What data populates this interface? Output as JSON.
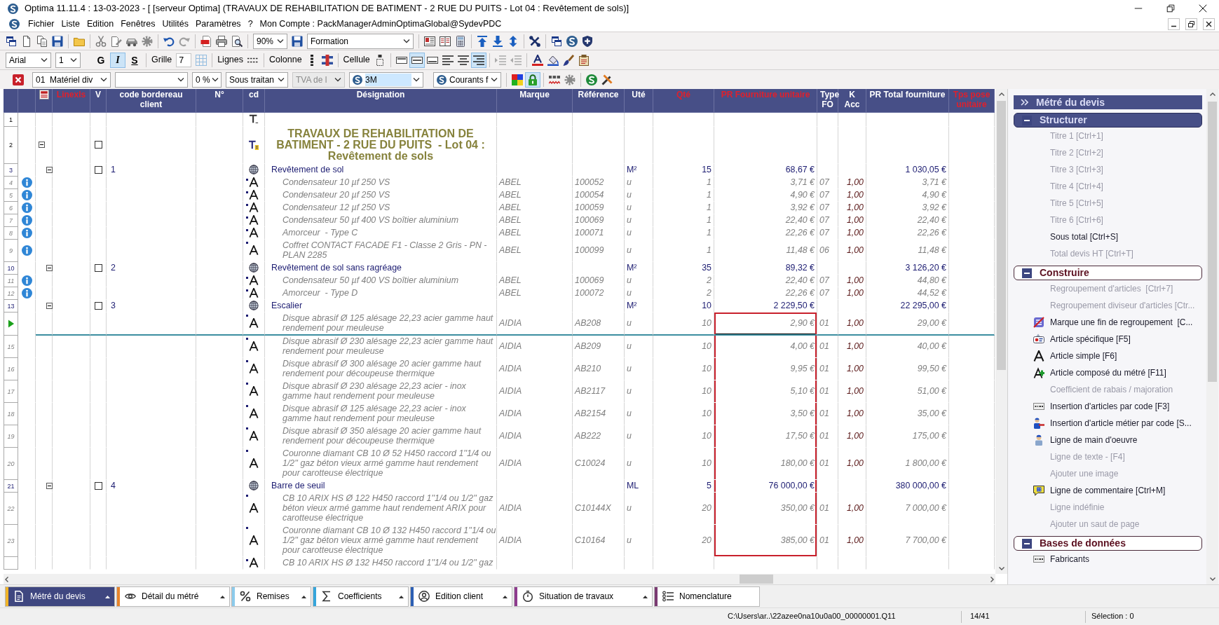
{
  "window": {
    "title": "Optima 11.11.4 : 13-03-2023 - [ [serveur Optima] (TRAVAUX DE REHABILITATION DE BATIMENT - 2 RUE DU PUITS - Lot 04 : Revêtement de sols)]"
  },
  "menu": {
    "items": [
      "Fichier",
      "Liste",
      "Edition",
      "Fenêtres",
      "Utilités",
      "Paramètres",
      "?"
    ],
    "account": "Mon Compte : PackManagerAdminOptimaGlobal@SydevPDC"
  },
  "main_toolbar": {
    "zoom": "90%",
    "profile": "Formation"
  },
  "format_bar": {
    "font": "Arial",
    "size": "1",
    "bold": {
      "label": "G",
      "pressed": false
    },
    "italic": {
      "label": "I",
      "pressed": true
    },
    "underline": {
      "label": "S",
      "pressed": false
    },
    "grid_label": "Grille",
    "grid_value": "7",
    "lines_label": "Lignes",
    "column_label": "Colonne",
    "cell_label": "Cellule",
    "border_buttons": [
      {
        "pressed": false
      },
      {
        "pressed": true
      },
      {
        "pressed": false
      }
    ],
    "align_buttons": [
      {
        "pressed": false
      },
      {
        "pressed": false
      },
      {
        "pressed": true
      }
    ]
  },
  "filter_bar": {
    "category": "01  Matériel div",
    "discount": "0 %",
    "subcontract": "Sous traitan",
    "vat": {
      "value": "TVA de l",
      "disabled": true
    },
    "supplier": {
      "value": "3M",
      "highlighted": true
    },
    "tariff": "Courants f",
    "lock_pressed": true
  },
  "table": {
    "columns": [
      {
        "label": "Linexls",
        "highlighted": true
      },
      {
        "label": "V",
        "highlighted": false
      },
      {
        "label": "code bordereau client",
        "highlighted": false
      },
      {
        "label": "N°",
        "highlighted": false
      },
      {
        "label": "cd",
        "highlighted": false
      },
      {
        "label": "Désignation",
        "highlighted": false
      },
      {
        "label": "Marque",
        "highlighted": false
      },
      {
        "label": "Référence",
        "highlighted": false
      },
      {
        "label": "Uté",
        "highlighted": false
      },
      {
        "label": "Qté",
        "highlighted": true
      },
      {
        "label": "PR Fourniture unitaire",
        "highlighted": true
      },
      {
        "label": "Type FO",
        "highlighted": false
      },
      {
        "label": "K Acc",
        "highlighted": false
      },
      {
        "label": "PR Total fourniture",
        "highlighted": false
      },
      {
        "label": "Tps pose unitaire",
        "highlighted": true
      }
    ],
    "rows": [
      {
        "number": "1",
        "kind": "text",
        "info": false,
        "current": false,
        "selected": false
      },
      {
        "number": "2",
        "kind": "title",
        "info": false,
        "current": false,
        "selected": false,
        "expanded": true,
        "checked": false,
        "designation": "TRAVAUX DE REHABILITATION DE BATIMENT - 2 RUE DU PUITS  - Lot 04 : Revêtement de sols",
        "children": [
          {
            "number": "3",
            "kind": "chapter",
            "info": false,
            "current": false,
            "selected": false,
            "expanded": true,
            "checked": false,
            "code": "1",
            "designation": "Revêtement de sol",
            "unit": "M²",
            "qty": "15",
            "unit_price": "68,67 €",
            "total": "1 030,05 €",
            "children": [
              {
                "number": "4",
                "kind": "article",
                "info": true,
                "current": false,
                "selected": false,
                "designation": "Condensateur 10 µf 250 VS",
                "brand": "ABEL",
                "reference": "100052",
                "unit": "u",
                "qty": "1",
                "unit_price": "3,71 €",
                "fo_type": "07",
                "k_acc": "1,00",
                "total": "3,71 €"
              },
              {
                "number": "5",
                "kind": "article",
                "info": true,
                "current": false,
                "selected": false,
                "designation": "Condensateur 20 µf 250 VS",
                "brand": "ABEL",
                "reference": "100054",
                "unit": "u",
                "qty": "1",
                "unit_price": "4,90 €",
                "fo_type": "07",
                "k_acc": "1,00",
                "total": "4,90 €"
              },
              {
                "number": "6",
                "kind": "article",
                "info": true,
                "current": false,
                "selected": false,
                "designation": "Condensateur 12 µf 250 VS",
                "brand": "ABEL",
                "reference": "100059",
                "unit": "u",
                "qty": "1",
                "unit_price": "3,92 €",
                "fo_type": "07",
                "k_acc": "1,00",
                "total": "3,92 €"
              },
              {
                "number": "7",
                "kind": "article",
                "info": true,
                "current": false,
                "selected": false,
                "designation": "Condensateur 50 µf 400 VS boîtier aluminium",
                "brand": "ABEL",
                "reference": "100069",
                "unit": "u",
                "qty": "1",
                "unit_price": "22,40 €",
                "fo_type": "07",
                "k_acc": "1,00",
                "total": "22,40 €"
              },
              {
                "number": "8",
                "kind": "article",
                "info": true,
                "current": false,
                "selected": false,
                "designation": "Amorceur  - Type C",
                "brand": "ABEL",
                "reference": "100071",
                "unit": "u",
                "qty": "1",
                "unit_price": "22,26 €",
                "fo_type": "07",
                "k_acc": "1,00",
                "total": "22,26 €"
              },
              {
                "number": "9",
                "kind": "article",
                "info": true,
                "current": false,
                "selected": false,
                "designation": "Coffret CONTACT FACADE F1 - Classe 2 Gris - PN - PLAN 2285",
                "brand": "ABEL",
                "reference": "100099",
                "unit": "u",
                "qty": "1",
                "unit_price": "11,48 €",
                "fo_type": "06",
                "k_acc": "1,00",
                "total": "11,48 €"
              }
            ]
          },
          {
            "number": "10",
            "kind": "chapter",
            "info": false,
            "current": false,
            "selected": false,
            "expanded": true,
            "checked": false,
            "code": "2",
            "designation": "Revêtement de sol sans ragréage",
            "unit": "M²",
            "qty": "35",
            "unit_price": "89,32 €",
            "total": "3 126,20 €",
            "children": [
              {
                "number": "11",
                "kind": "article",
                "info": true,
                "current": false,
                "selected": false,
                "designation": "Condensateur 50 µf 400 VS boîtier aluminium",
                "brand": "ABEL",
                "reference": "100069",
                "unit": "u",
                "qty": "2",
                "unit_price": "22,40 €",
                "fo_type": "07",
                "k_acc": "1,00",
                "total": "44,80 €"
              },
              {
                "number": "12",
                "kind": "article",
                "info": true,
                "current": false,
                "selected": false,
                "designation": "Amorceur  - Type D",
                "brand": "ABEL",
                "reference": "100072",
                "unit": "u",
                "qty": "2",
                "unit_price": "22,26 €",
                "fo_type": "07",
                "k_acc": "1,00",
                "total": "44,52 €"
              }
            ]
          },
          {
            "number": "13",
            "kind": "chapter",
            "info": false,
            "current": false,
            "selected": false,
            "expanded": true,
            "checked": false,
            "code": "3",
            "designation": "Escalier",
            "unit": "M²",
            "qty": "10",
            "unit_price": "2 229,50 €",
            "total": "22 295,00 €",
            "children": [
              {
                "kind": "article",
                "info": false,
                "current": true,
                "selected": true,
                "designation": "Disque abrasif Ø 125 alésage 22,23 acier gamme haut rendement pour meuleuse",
                "brand": "AIDIA",
                "reference": "AB208",
                "unit": "u",
                "qty": "10",
                "unit_price": "2,90 €",
                "fo_type": "01",
                "k_acc": "1,00",
                "total": "29,00 €"
              },
              {
                "number": "15",
                "kind": "article",
                "info": false,
                "current": false,
                "selected": true,
                "designation": "Disque abrasif Ø 230 alésage 22,23 acier gamme haut rendement pour meuleuse",
                "brand": "AIDIA",
                "reference": "AB209",
                "unit": "u",
                "qty": "10",
                "unit_price": "4,00 €",
                "fo_type": "01",
                "k_acc": "1,00",
                "total": "40,00 €"
              },
              {
                "number": "16",
                "kind": "article",
                "info": false,
                "current": false,
                "selected": true,
                "designation": "Disque abrasif Ø 300 alésage 20 acier gamme haut rendement pour découpeuse thermique",
                "brand": "AIDIA",
                "reference": "AB210",
                "unit": "u",
                "qty": "10",
                "unit_price": "9,95 €",
                "fo_type": "01",
                "k_acc": "1,00",
                "total": "99,50 €"
              },
              {
                "number": "17",
                "kind": "article",
                "info": false,
                "current": false,
                "selected": true,
                "designation": "Disque abrasif Ø 230 alésage 22,23 acier - inox gamme haut rendement pour meuleuse",
                "brand": "AIDIA",
                "reference": "AB2117",
                "unit": "u",
                "qty": "10",
                "unit_price": "5,10 €",
                "fo_type": "01",
                "k_acc": "1,00",
                "total": "51,00 €"
              },
              {
                "number": "18",
                "kind": "article",
                "info": false,
                "current": false,
                "selected": true,
                "designation": "Disque abrasif Ø 125 alésage 22,23 acier - inox gamme haut rendement pour meuleuse",
                "brand": "AIDIA",
                "reference": "AB2154",
                "unit": "u",
                "qty": "10",
                "unit_price": "3,50 €",
                "fo_type": "01",
                "k_acc": "1,00",
                "total": "35,00 €"
              },
              {
                "number": "19",
                "kind": "article",
                "info": false,
                "current": false,
                "selected": true,
                "designation": "Disque abrasif Ø 350 alésage 20 acier gamme haut rendement pour découpeuse thermique",
                "brand": "AIDIA",
                "reference": "AB222",
                "unit": "u",
                "qty": "10",
                "unit_price": "17,50 €",
                "fo_type": "01",
                "k_acc": "1,00",
                "total": "175,00 €"
              },
              {
                "number": "20",
                "kind": "article",
                "info": false,
                "current": false,
                "selected": true,
                "designation": "Couronne diamant CB 10 Ø 52 H450 raccord 1''1/4 ou 1/2'' gaz béton vieux armé gamme haut rendement pour carotteuse électrique",
                "brand": "AIDIA",
                "reference": "C10024",
                "unit": "u",
                "qty": "10",
                "unit_price": "180,00 €",
                "fo_type": "01",
                "k_acc": "1,00",
                "total": "1 800,00 €"
              }
            ]
          },
          {
            "number": "21",
            "kind": "chapter",
            "info": false,
            "current": false,
            "selected": true,
            "expanded": true,
            "checked": false,
            "code": "4",
            "designation": "Barre de seuil",
            "unit": "ML",
            "qty": "5",
            "unit_price": "76 000,00 €",
            "total": "380 000,00 €",
            "children": [
              {
                "number": "22",
                "kind": "article",
                "info": false,
                "current": false,
                "selected": true,
                "designation": "CB 10 ARIX HS Ø 122 H450 raccord 1''1/4 ou 1/2'' gaz béton vieux armé gamme haut rendement ARIX pour carotteuse électrique",
                "brand": "AIDIA",
                "reference": "C10144X",
                "unit": "u",
                "qty": "20",
                "unit_price": "350,00 €",
                "fo_type": "01",
                "k_acc": "1,00",
                "total": "7 000,00 €"
              },
              {
                "number": "23",
                "kind": "article",
                "info": false,
                "current": false,
                "selected": true,
                "designation": "Couronne diamant CB 10 Ø 132 H450 raccord 1''1/4 ou 1/2'' gaz béton vieux armé gamme haut rendement pour carotteuse électrique",
                "brand": "AIDIA",
                "reference": "C10164",
                "unit": "u",
                "qty": "20",
                "unit_price": "385,00 €",
                "fo_type": "01",
                "k_acc": "1,00",
                "total": "7 700,00 €"
              },
              {
                "kind": "article",
                "info": false,
                "current": false,
                "selected": false,
                "designation": "CB 10 ARIX HS Ø 132 H450 raccord 1''1/4 ou 1/2'' gaz"
              }
            ]
          }
        ]
      }
    ]
  },
  "side_panel": {
    "title": "Métré du devis",
    "sections": [
      {
        "label": "Structurer",
        "expanded": true,
        "selected": true,
        "items": [
          {
            "label": "Titre 1 [Ctrl+1]",
            "kind": "plain",
            "disabled": true
          },
          {
            "label": "Titre 2 [Ctrl+2]",
            "kind": "plain",
            "disabled": true
          },
          {
            "label": "Titre 3 [Ctrl+3]",
            "kind": "plain",
            "disabled": true
          },
          {
            "label": "Titre 4 [Ctrl+4]",
            "kind": "plain",
            "disabled": true
          },
          {
            "label": "Titre 5 [Ctrl+5]",
            "kind": "plain",
            "disabled": true
          },
          {
            "label": "Titre 6 [Ctrl+6]",
            "kind": "plain",
            "disabled": true
          },
          {
            "label": "Sous total [Ctrl+S]",
            "kind": "plain",
            "disabled": false
          },
          {
            "label": "Total devis HT [Ctrl+T]",
            "kind": "plain",
            "disabled": true
          }
        ]
      },
      {
        "label": "Construire",
        "expanded": true,
        "selected": false,
        "items": [
          {
            "label": "Regroupement d'articles  [Ctrl+7]",
            "kind": "plain",
            "disabled": true
          },
          {
            "label": "Regroupement diviseur d'articles [Ctr...",
            "kind": "plain",
            "disabled": true
          },
          {
            "label": "Marque une fin de regroupement  [C...",
            "kind": "group-end",
            "disabled": false
          },
          {
            "label": "Article spécifique [F5]",
            "kind": "specific",
            "disabled": false
          },
          {
            "label": "Article simple [F6]",
            "kind": "simple",
            "disabled": false
          },
          {
            "label": "Article composé du métré [F11]",
            "kind": "composed",
            "disabled": false
          },
          {
            "label": "Coefficient de rabais / majoration",
            "kind": "plain",
            "disabled": true
          },
          {
            "label": "Insertion d'articles par code [F3]",
            "kind": "code",
            "disabled": false
          },
          {
            "label": "Insertion d'article métier par code [S...",
            "kind": "trade-code",
            "disabled": false
          },
          {
            "label": "Ligne de main d'oeuvre",
            "kind": "labour",
            "disabled": false
          },
          {
            "label": "Ligne de texte - [F4]",
            "kind": "plain",
            "disabled": true
          },
          {
            "label": "Ajouter une image",
            "kind": "plain",
            "disabled": true
          },
          {
            "label": "Ligne de commentaire [Ctrl+M]",
            "kind": "comment",
            "disabled": false
          },
          {
            "label": "Ligne indéfinie",
            "kind": "plain",
            "disabled": true
          },
          {
            "label": "Ajouter un saut de page",
            "kind": "plain",
            "disabled": true
          }
        ]
      },
      {
        "label": "Bases de données",
        "expanded": true,
        "selected": false,
        "items": [
          {
            "label": "Fabricants",
            "kind": "code",
            "disabled": false
          }
        ]
      }
    ]
  },
  "bottom_tabs": [
    {
      "label": "Métré du devis",
      "selected": true,
      "color": "#f0b429",
      "menu": true
    },
    {
      "label": "Détail du métré",
      "selected": false,
      "color": "#e8842a",
      "menu": true
    },
    {
      "label": "Remises",
      "selected": false,
      "color": "#8ccbec",
      "menu": true
    },
    {
      "label": "Coefficients",
      "selected": false,
      "color": "#36a6dc",
      "menu": true
    },
    {
      "label": "Edition client",
      "selected": false,
      "color": "#2c5fb4",
      "menu": true
    },
    {
      "label": "Situation de travaux",
      "selected": false,
      "color": "#8e3b8e",
      "menu": true
    },
    {
      "label": "Nomenclature",
      "selected": false,
      "color": "#7a3a72",
      "menu": false
    }
  ],
  "status_bar": {
    "file": "C:\\Users\\ar..\\22azee0na10u0a00_00000001.Q11",
    "position": "14/41",
    "selection": "Sélection : 0"
  }
}
